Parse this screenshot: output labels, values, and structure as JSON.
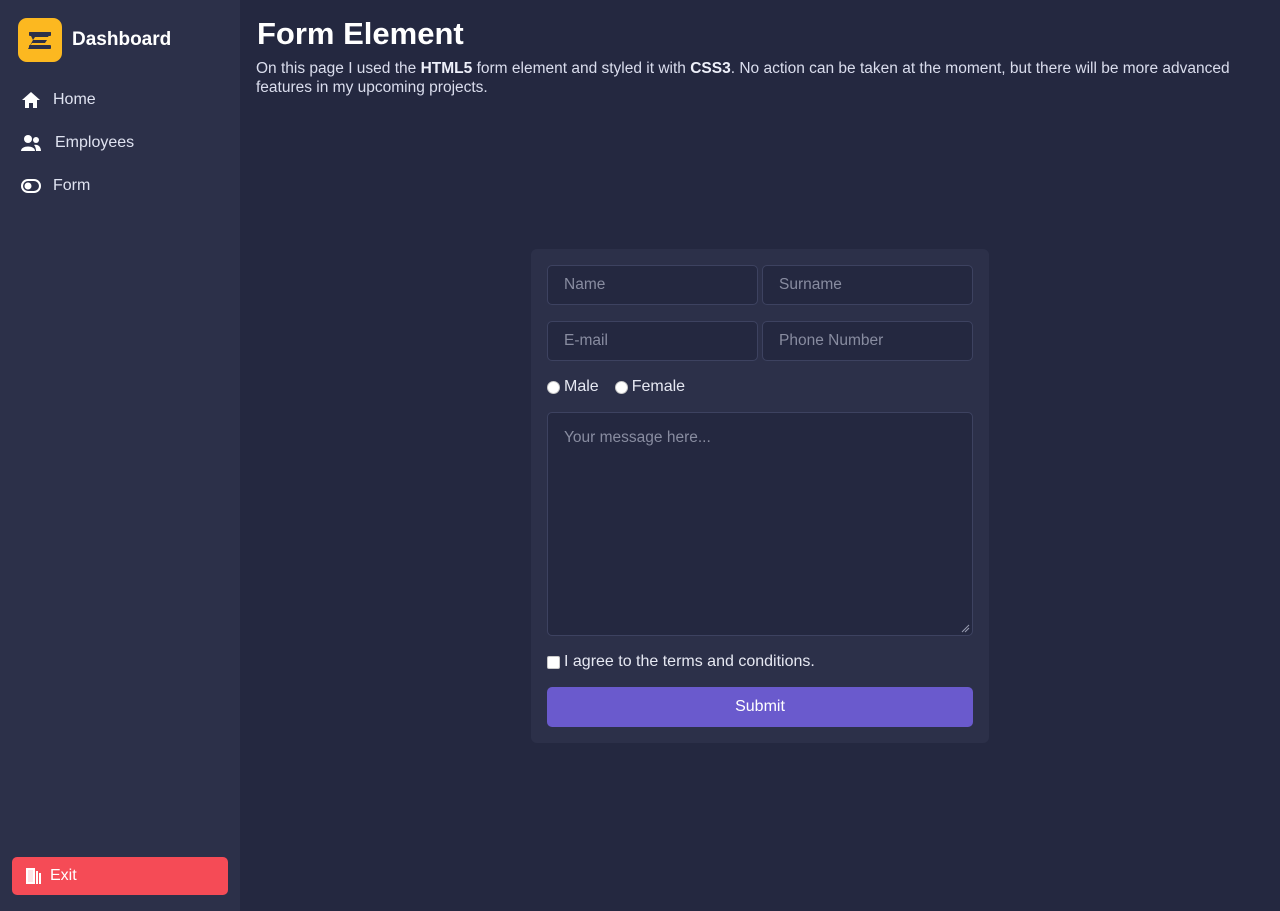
{
  "sidebar": {
    "brand_title": "Dashboard",
    "logo_icon": "z-logo-icon",
    "items": [
      {
        "label": "Home",
        "icon": "home-icon"
      },
      {
        "label": "Employees",
        "icon": "users-icon"
      },
      {
        "label": "Form",
        "icon": "toggle-icon"
      }
    ],
    "exit_label": "Exit",
    "exit_icon": "door-exit-icon"
  },
  "page": {
    "title": "Form Element",
    "desc_prefix": "On this page I used the ",
    "desc_html5": "HTML5",
    "desc_mid": " form element and styled it with ",
    "desc_css3": "CSS3",
    "desc_suffix": ". No action can be taken at the moment, but there will be more advanced features in my upcoming projects."
  },
  "form": {
    "name_placeholder": "Name",
    "surname_placeholder": "Surname",
    "email_placeholder": "E-mail",
    "phone_placeholder": "Phone Number",
    "gender_options": [
      "Male",
      "Female"
    ],
    "message_placeholder": "Your message here...",
    "agree_label": "I agree to the terms and conditions.",
    "submit_label": "Submit"
  },
  "colors": {
    "background": "#242840",
    "sidebar": "#2c3049",
    "brand_logo": "#fcb820",
    "exit_button": "#f54b56",
    "submit_button": "#6a5acd"
  }
}
